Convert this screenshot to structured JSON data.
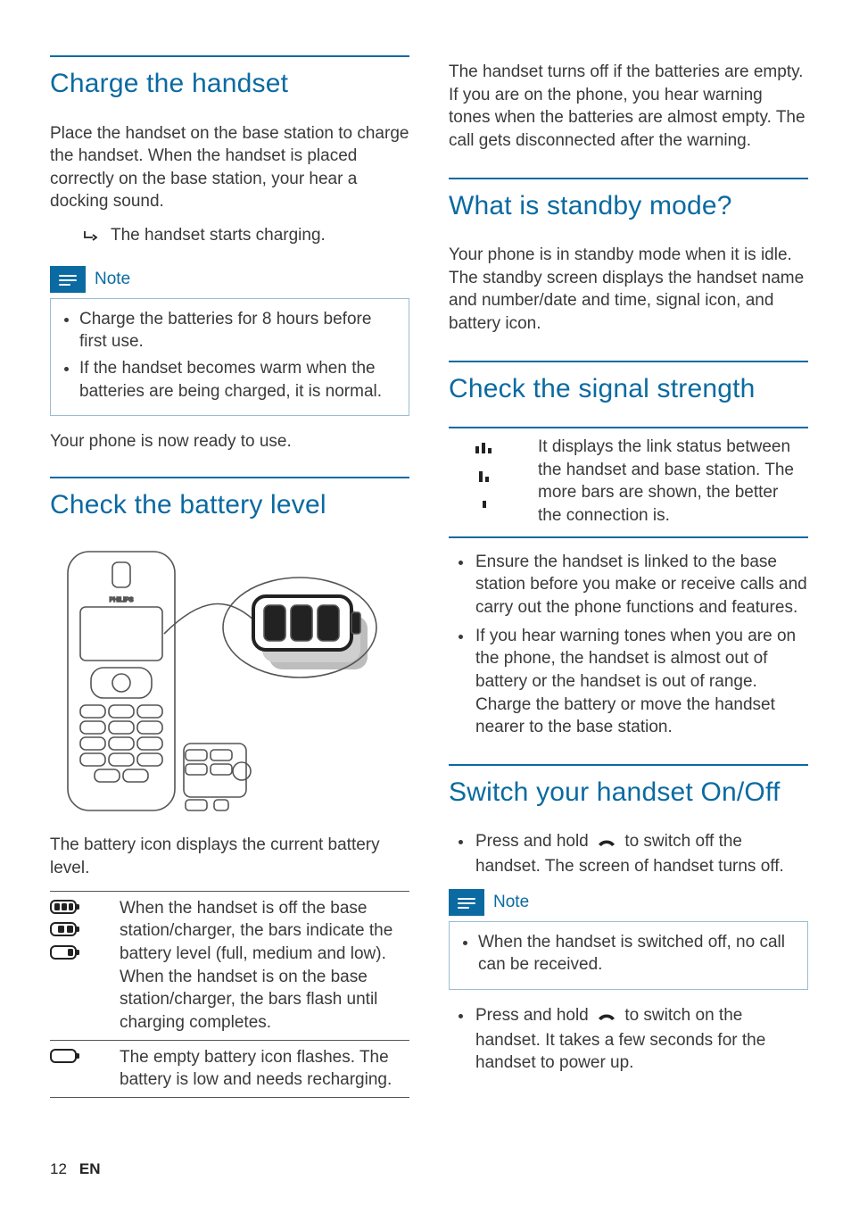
{
  "left": {
    "h1": "Charge the handset",
    "p1": "Place the handset on the base station to charge the handset. When the handset is placed correctly on the base station, your hear a docking sound.",
    "arrow_line": "The handset starts charging.",
    "note_title": "Note",
    "note_items": [
      "Charge the batteries for 8 hours before first use.",
      "If the handset becomes warm when the batteries are being charged, it is normal."
    ],
    "p2": "Your phone is now ready to use.",
    "h2": "Check the battery level",
    "p3": "The battery icon displays the current battery level.",
    "table": [
      {
        "desc": "When the handset is off the base station/charger, the bars indicate the battery level (full, medium and low).\nWhen the handset is on the base station/charger, the bars flash until charging completes."
      },
      {
        "desc": "The empty battery icon flashes. The battery is low and needs recharging."
      }
    ]
  },
  "right": {
    "p1": "The handset turns off if the batteries are empty. If you are on the phone, you hear warning tones when the batteries are almost empty. The call gets disconnected after the warning.",
    "h1": "What is standby mode?",
    "p2": "Your phone is in standby mode when it is idle. The standby screen displays the handset name and number/date and time, signal icon, and battery icon.",
    "h2": "Check the signal strength",
    "sig_desc": "It displays the link status between the handset and base station. The more bars are shown, the better the connection is.",
    "sig_bullets": [
      "Ensure the handset is linked to the base station before you make or receive calls and carry out the phone functions and features.",
      "If you hear warning tones when you are on the phone, the handset is almost out of battery or the handset is out of range. Charge the battery or move the handset nearer to the base station."
    ],
    "h3": "Switch your handset On/Off",
    "switch_off_pre": "Press and hold ",
    "switch_off_post": " to switch off the handset. The screen of handset turns off.",
    "note_title": "Note",
    "note_items": [
      "When the handset is switched off, no call can be received."
    ],
    "switch_on_pre": "Press and hold ",
    "switch_on_post": " to switch on the handset. It takes a few seconds for the handset to power up."
  },
  "footer": {
    "page": "12",
    "lang": "EN"
  }
}
